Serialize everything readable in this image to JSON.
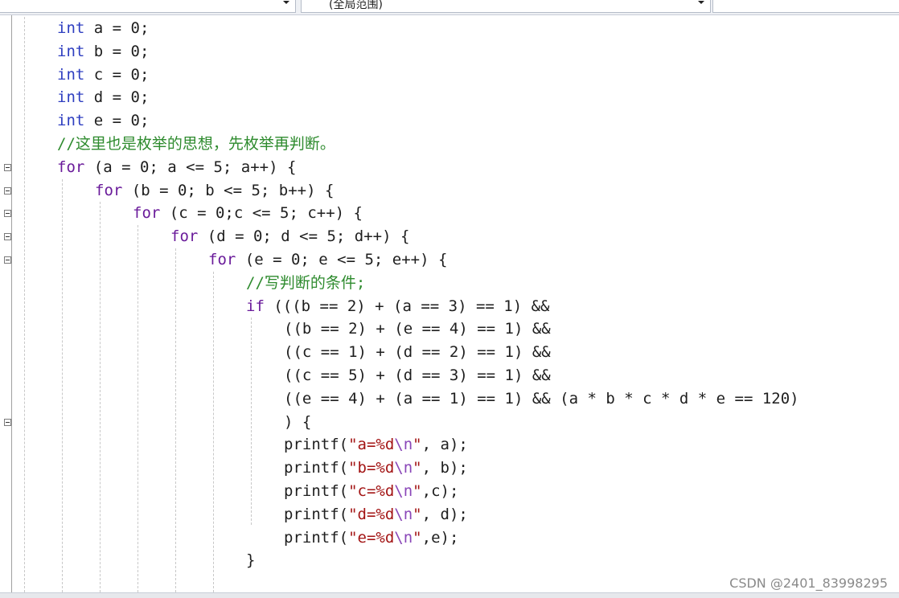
{
  "navbar": {
    "dropdown_scope": "(全局范围)"
  },
  "code_lines": [
    {
      "indent": 0,
      "parts": [
        [
          "kw2",
          "int"
        ],
        [
          "p",
          " a = 0;"
        ]
      ]
    },
    {
      "indent": 0,
      "parts": [
        [
          "kw2",
          "int"
        ],
        [
          "p",
          " b = 0;"
        ]
      ]
    },
    {
      "indent": 0,
      "parts": [
        [
          "kw2",
          "int"
        ],
        [
          "p",
          " c = 0;"
        ]
      ]
    },
    {
      "indent": 0,
      "parts": [
        [
          "kw2",
          "int"
        ],
        [
          "p",
          " d = 0;"
        ]
      ]
    },
    {
      "indent": 0,
      "parts": [
        [
          "kw2",
          "int"
        ],
        [
          "p",
          " e = 0;"
        ]
      ]
    },
    {
      "indent": 0,
      "parts": [
        [
          "cm",
          "//这里也是枚举的思想，先枚举再判断。"
        ]
      ]
    },
    {
      "indent": 0,
      "parts": [
        [
          "kw",
          "for"
        ],
        [
          "p",
          " (a = 0; a <= 5; a++) {"
        ]
      ]
    },
    {
      "indent": 1,
      "parts": [
        [
          "kw",
          "for"
        ],
        [
          "p",
          " (b = 0; b <= 5; b++) {"
        ]
      ]
    },
    {
      "indent": 2,
      "parts": [
        [
          "kw",
          "for"
        ],
        [
          "p",
          " (c = 0;c <= 5; c++) {"
        ]
      ]
    },
    {
      "indent": 3,
      "parts": [
        [
          "kw",
          "for"
        ],
        [
          "p",
          " (d = 0; d <= 5; d++) {"
        ]
      ]
    },
    {
      "indent": 4,
      "parts": [
        [
          "kw",
          "for"
        ],
        [
          "p",
          " (e = 0; e <= 5; e++) {"
        ]
      ]
    },
    {
      "indent": 5,
      "parts": [
        [
          "cm",
          "//写判断的条件;"
        ]
      ]
    },
    {
      "indent": 5,
      "parts": [
        [
          "kw",
          "if"
        ],
        [
          "p",
          " (((b == 2) + (a == 3) == 1) &&"
        ]
      ]
    },
    {
      "indent": 6,
      "parts": [
        [
          "p",
          "((b == 2) + (e == 4) == 1) &&"
        ]
      ]
    },
    {
      "indent": 6,
      "parts": [
        [
          "p",
          "((c == 1) + (d == 2) == 1) &&"
        ]
      ]
    },
    {
      "indent": 6,
      "parts": [
        [
          "p",
          "((c == 5) + (d == 3) == 1) &&"
        ]
      ]
    },
    {
      "indent": 6,
      "parts": [
        [
          "p",
          "((e == 4) + (a == 1) == 1) && (a * b * c * d * e == 120)"
        ]
      ]
    },
    {
      "indent": 6,
      "parts": [
        [
          "p",
          ") {"
        ]
      ]
    },
    {
      "indent": 6,
      "parts": [
        [
          "p",
          "printf("
        ],
        [
          "str",
          "\"a=%d"
        ],
        [
          "esc",
          "\\n"
        ],
        [
          "str",
          "\""
        ],
        [
          "p",
          ", a);"
        ]
      ]
    },
    {
      "indent": 6,
      "parts": [
        [
          "p",
          "printf("
        ],
        [
          "str",
          "\"b=%d"
        ],
        [
          "esc",
          "\\n"
        ],
        [
          "str",
          "\""
        ],
        [
          "p",
          ", b);"
        ]
      ]
    },
    {
      "indent": 6,
      "parts": [
        [
          "p",
          "printf("
        ],
        [
          "str",
          "\"c=%d"
        ],
        [
          "esc",
          "\\n"
        ],
        [
          "str",
          "\""
        ],
        [
          "p",
          ",c);"
        ]
      ]
    },
    {
      "indent": 6,
      "parts": [
        [
          "p",
          "printf("
        ],
        [
          "str",
          "\"d=%d"
        ],
        [
          "esc",
          "\\n"
        ],
        [
          "str",
          "\""
        ],
        [
          "p",
          ", d);"
        ]
      ]
    },
    {
      "indent": 6,
      "parts": [
        [
          "p",
          "printf("
        ],
        [
          "str",
          "\"e=%d"
        ],
        [
          "esc",
          "\\n"
        ],
        [
          "str",
          "\""
        ],
        [
          "p",
          ",e);"
        ]
      ]
    },
    {
      "indent": 5,
      "parts": [
        [
          "p",
          "}"
        ]
      ]
    }
  ],
  "fold_markers_on_lines": [
    6,
    7,
    8,
    9,
    10,
    17
  ],
  "watermark": "CSDN @2401_83998295"
}
